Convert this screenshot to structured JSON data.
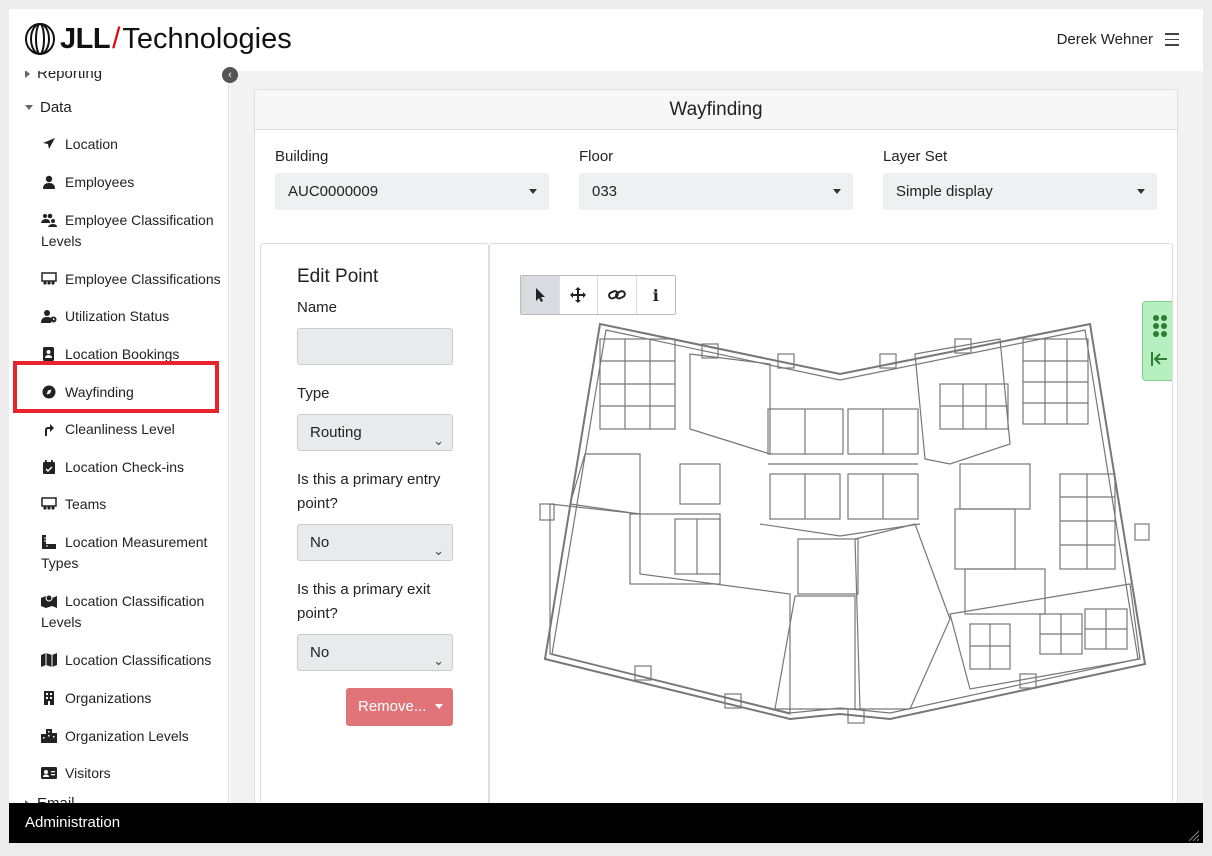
{
  "header": {
    "brand": "JLL",
    "slash": "/",
    "product": "Technologies",
    "user_name": "Derek Wehner",
    "menu_icon": "hamburger-icon"
  },
  "sidebar": {
    "groups": {
      "reporting": "Reporting",
      "data": "Data",
      "email": "Email"
    },
    "items": [
      {
        "label": "Location",
        "icon": "location-arrow-icon"
      },
      {
        "label": "Employees",
        "icon": "user-icon"
      },
      {
        "label": "Employee Classification Levels",
        "icon": "users-icon"
      },
      {
        "label": "Employee Classifications",
        "icon": "chalkboard-users-icon"
      },
      {
        "label": "Utilization Status",
        "icon": "user-clock-icon"
      },
      {
        "label": "Location Bookings",
        "icon": "address-book-icon"
      },
      {
        "label": "Wayfinding",
        "icon": "compass-icon"
      },
      {
        "label": "Cleanliness Level",
        "icon": "turn-up-icon"
      },
      {
        "label": "Location Check-ins",
        "icon": "calendar-check-icon"
      },
      {
        "label": "Teams",
        "icon": "chalkboard-users-icon"
      },
      {
        "label": "Location Measurement Types",
        "icon": "ruler-icon"
      },
      {
        "label": "Location Classification Levels",
        "icon": "map-marked-icon"
      },
      {
        "label": "Location Classifications",
        "icon": "map-icon"
      },
      {
        "label": "Organizations",
        "icon": "building-icon"
      },
      {
        "label": "Organization Levels",
        "icon": "city-icon"
      },
      {
        "label": "Visitors",
        "icon": "id-card-icon"
      }
    ]
  },
  "main": {
    "title": "Wayfinding",
    "filters": {
      "building_label": "Building",
      "building_value": "AUC0000009",
      "floor_label": "Floor",
      "floor_value": "033",
      "layer_label": "Layer Set",
      "layer_value": "Simple display"
    },
    "edit_point": {
      "heading": "Edit Point",
      "name_label": "Name",
      "name_value": "",
      "type_label": "Type",
      "type_value": "Routing",
      "entry_label": "Is this a primary entry point?",
      "entry_value": "No",
      "exit_label": "Is this a primary exit point?",
      "exit_value": "No",
      "remove_label": "Remove..."
    },
    "map_tools": [
      "pointer-icon",
      "move-icon",
      "link-icon",
      "info-icon"
    ],
    "map_tool_info_glyph": "i"
  },
  "footer": {
    "label": "Administration"
  },
  "colors": {
    "highlight": "#e8232a",
    "remove_button": "#e07479",
    "side_tab": "#b7f0c0",
    "brand_slash": "#e30613"
  }
}
